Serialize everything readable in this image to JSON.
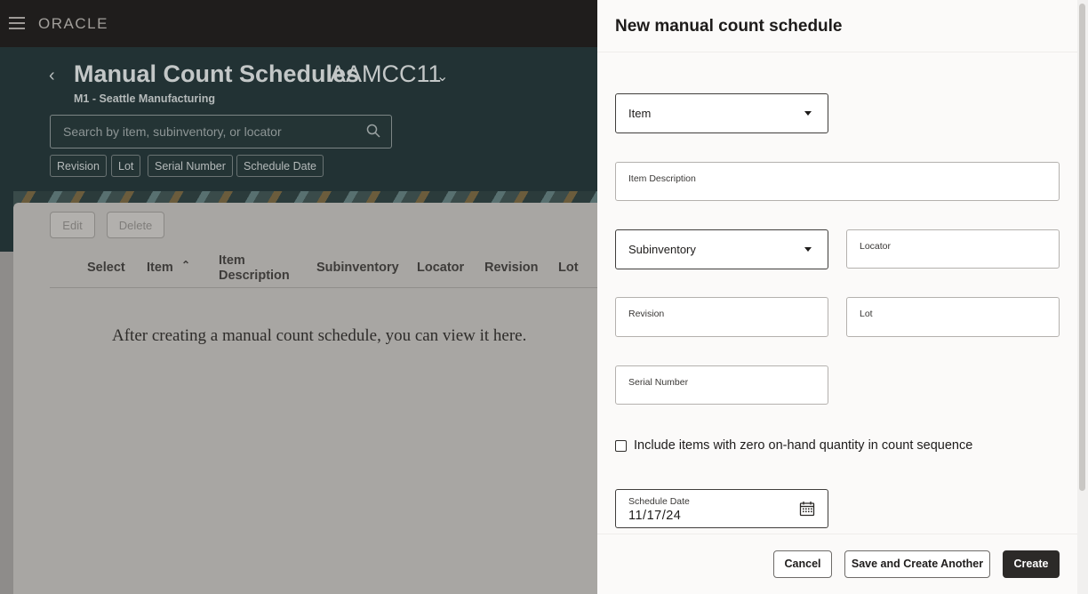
{
  "app": {
    "brand": "ORACLE",
    "page_title": "Manual Count Schedules",
    "page_code": "AAMCC11",
    "subtitle": "M1 - Seattle Manufacturing",
    "search_placeholder": "Search by item, subinventory, or locator",
    "filter_chips": [
      "Revision",
      "Lot",
      "Serial Number",
      "Schedule Date"
    ],
    "actions": {
      "edit": "Edit",
      "delete": "Delete"
    },
    "columns": [
      "Select",
      "Item",
      "Item Description",
      "Subinventory",
      "Locator",
      "Revision",
      "Lot"
    ],
    "empty_message": "After creating a manual count schedule, you can view it here."
  },
  "drawer": {
    "title": "New manual count schedule",
    "fields": {
      "item": "Item",
      "item_description": "Item Description",
      "subinventory": "Subinventory",
      "locator": "Locator",
      "revision": "Revision",
      "lot": "Lot",
      "serial_number": "Serial Number"
    },
    "checkbox": {
      "label": "Include items with zero on-hand quantity in count sequence",
      "checked": false
    },
    "schedule_date": {
      "label": "Schedule Date",
      "value": "11/17/24"
    },
    "buttons": {
      "cancel": "Cancel",
      "save_create_another": "Save and Create Another",
      "create": "Create"
    }
  }
}
